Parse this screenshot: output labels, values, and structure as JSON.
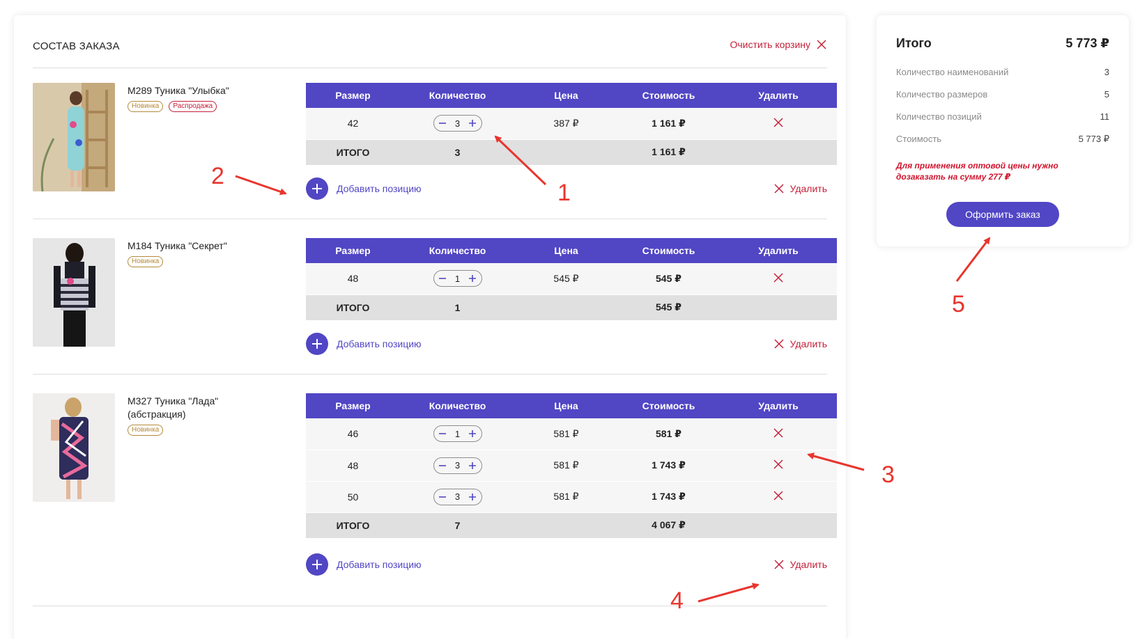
{
  "order": {
    "title": "СОСТАВ ЗАКАЗА",
    "clear_label": "Очистить корзину",
    "table_headers": {
      "size": "Размер",
      "qty": "Количество",
      "price": "Цена",
      "cost": "Стоимость",
      "delete": "Удалить"
    },
    "total_row_label": "ИТОГО",
    "add_label": "Добавить позицию",
    "delete_label": "Удалить",
    "products": [
      {
        "name": "М289 Туника \"Улыбка\"",
        "badges": [
          {
            "text": "Новинка",
            "kind": "new"
          },
          {
            "text": "Распродажа",
            "kind": "sale"
          }
        ],
        "rows": [
          {
            "size": "42",
            "qty": "3",
            "price": "387 ₽",
            "cost": "1 161 ₽"
          }
        ],
        "total_qty": "3",
        "total_cost": "1 161 ₽"
      },
      {
        "name": "М184 Туника \"Секрет\"",
        "badges": [
          {
            "text": "Новинка",
            "kind": "new"
          }
        ],
        "rows": [
          {
            "size": "48",
            "qty": "1",
            "price": "545 ₽",
            "cost": "545 ₽"
          }
        ],
        "total_qty": "1",
        "total_cost": "545 ₽"
      },
      {
        "name": "М327 Туника \"Лада\" (абстракция)",
        "badges": [
          {
            "text": "Новинка",
            "kind": "new"
          }
        ],
        "rows": [
          {
            "size": "46",
            "qty": "1",
            "price": "581 ₽",
            "cost": "581 ₽"
          },
          {
            "size": "48",
            "qty": "3",
            "price": "581 ₽",
            "cost": "1 743 ₽"
          },
          {
            "size": "50",
            "qty": "3",
            "price": "581 ₽",
            "cost": "1 743 ₽"
          }
        ],
        "total_qty": "7",
        "total_cost": "4 067 ₽"
      }
    ]
  },
  "summary": {
    "title": "Итого",
    "total": "5 773 ₽",
    "rows": [
      {
        "label": "Количество наименований",
        "value": "3"
      },
      {
        "label": "Количество размеров",
        "value": "5"
      },
      {
        "label": "Количество позиций",
        "value": "11"
      },
      {
        "label": "Стоимость",
        "value": "5 773 ₽"
      }
    ],
    "note": "Для применения оптовой цены нужно дозаказать на сумму 277 ₽",
    "checkout_label": "Оформить заказ"
  },
  "annotations": [
    "1",
    "2",
    "3",
    "4",
    "5"
  ],
  "colors": {
    "accent": "#5146c4",
    "danger": "#c4203a",
    "annotation": "#e8352e",
    "badge_new": "#b5893a"
  },
  "icons": {
    "remove": "close-icon",
    "add": "plus-icon",
    "decrement": "minus-icon",
    "increment": "plus-icon"
  }
}
